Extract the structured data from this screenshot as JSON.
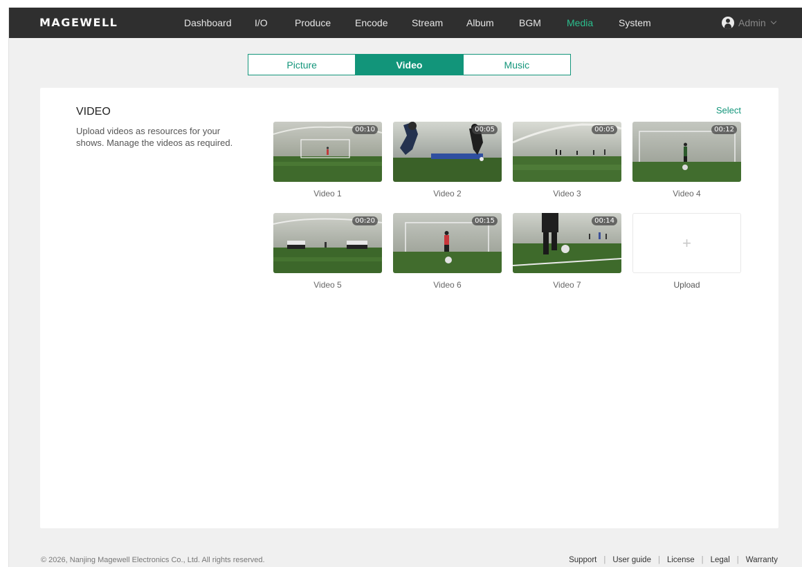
{
  "brand": {
    "logo": "MAGEWELL"
  },
  "nav": {
    "items": [
      {
        "label": "Dashboard",
        "active": false
      },
      {
        "label": "I/O",
        "active": false
      },
      {
        "label": "Produce",
        "active": false
      },
      {
        "label": "Encode",
        "active": false
      },
      {
        "label": "Stream",
        "active": false
      },
      {
        "label": "Album",
        "active": false
      },
      {
        "label": "BGM",
        "active": false
      },
      {
        "label": "Media",
        "active": true
      },
      {
        "label": "System",
        "active": false
      }
    ],
    "user": {
      "name": "Admin",
      "icon": "user-avatar-icon"
    }
  },
  "tabs": [
    {
      "label": "Picture",
      "active": false
    },
    {
      "label": "Video",
      "active": true
    },
    {
      "label": "Music",
      "active": false
    }
  ],
  "section": {
    "title": "VIDEO",
    "description": "Upload videos as resources for your shows. Manage the videos as required.",
    "select_label": "Select"
  },
  "videos": [
    {
      "name": "Video 1",
      "duration": "00:10"
    },
    {
      "name": "Video 2",
      "duration": "00:05"
    },
    {
      "name": "Video 3",
      "duration": "00:05"
    },
    {
      "name": "Video 4",
      "duration": "00:12"
    },
    {
      "name": "Video 5",
      "duration": "00:20"
    },
    {
      "name": "Video 6",
      "duration": "00:15"
    },
    {
      "name": "Video 7",
      "duration": "00:14"
    }
  ],
  "upload": {
    "label": "Upload",
    "icon": "plus-icon"
  },
  "footer": {
    "copyright": "© 2026, Nanjing Magewell Electronics Co., Ltd. All rights reserved.",
    "links": [
      "Support",
      "User guide",
      "License",
      "Legal",
      "Warranty"
    ]
  },
  "colors": {
    "accent": "#12957a",
    "nav_active": "#2bbf8e",
    "topbar": "#2f2f2f"
  }
}
